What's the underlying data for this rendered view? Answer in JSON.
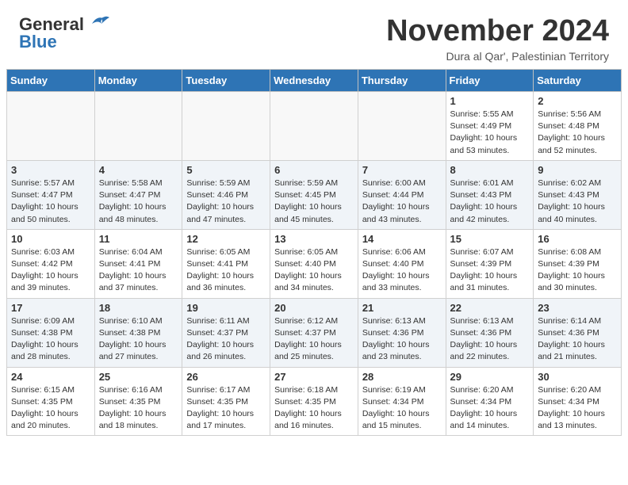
{
  "header": {
    "logo_line1": "General",
    "logo_line2": "Blue",
    "month": "November 2024",
    "location": "Dura al Qar', Palestinian Territory"
  },
  "weekdays": [
    "Sunday",
    "Monday",
    "Tuesday",
    "Wednesday",
    "Thursday",
    "Friday",
    "Saturday"
  ],
  "weeks": [
    [
      {
        "day": "",
        "info": ""
      },
      {
        "day": "",
        "info": ""
      },
      {
        "day": "",
        "info": ""
      },
      {
        "day": "",
        "info": ""
      },
      {
        "day": "",
        "info": ""
      },
      {
        "day": "1",
        "info": "Sunrise: 5:55 AM\nSunset: 4:49 PM\nDaylight: 10 hours and 53 minutes."
      },
      {
        "day": "2",
        "info": "Sunrise: 5:56 AM\nSunset: 4:48 PM\nDaylight: 10 hours and 52 minutes."
      }
    ],
    [
      {
        "day": "3",
        "info": "Sunrise: 5:57 AM\nSunset: 4:47 PM\nDaylight: 10 hours and 50 minutes."
      },
      {
        "day": "4",
        "info": "Sunrise: 5:58 AM\nSunset: 4:47 PM\nDaylight: 10 hours and 48 minutes."
      },
      {
        "day": "5",
        "info": "Sunrise: 5:59 AM\nSunset: 4:46 PM\nDaylight: 10 hours and 47 minutes."
      },
      {
        "day": "6",
        "info": "Sunrise: 5:59 AM\nSunset: 4:45 PM\nDaylight: 10 hours and 45 minutes."
      },
      {
        "day": "7",
        "info": "Sunrise: 6:00 AM\nSunset: 4:44 PM\nDaylight: 10 hours and 43 minutes."
      },
      {
        "day": "8",
        "info": "Sunrise: 6:01 AM\nSunset: 4:43 PM\nDaylight: 10 hours and 42 minutes."
      },
      {
        "day": "9",
        "info": "Sunrise: 6:02 AM\nSunset: 4:43 PM\nDaylight: 10 hours and 40 minutes."
      }
    ],
    [
      {
        "day": "10",
        "info": "Sunrise: 6:03 AM\nSunset: 4:42 PM\nDaylight: 10 hours and 39 minutes."
      },
      {
        "day": "11",
        "info": "Sunrise: 6:04 AM\nSunset: 4:41 PM\nDaylight: 10 hours and 37 minutes."
      },
      {
        "day": "12",
        "info": "Sunrise: 6:05 AM\nSunset: 4:41 PM\nDaylight: 10 hours and 36 minutes."
      },
      {
        "day": "13",
        "info": "Sunrise: 6:05 AM\nSunset: 4:40 PM\nDaylight: 10 hours and 34 minutes."
      },
      {
        "day": "14",
        "info": "Sunrise: 6:06 AM\nSunset: 4:40 PM\nDaylight: 10 hours and 33 minutes."
      },
      {
        "day": "15",
        "info": "Sunrise: 6:07 AM\nSunset: 4:39 PM\nDaylight: 10 hours and 31 minutes."
      },
      {
        "day": "16",
        "info": "Sunrise: 6:08 AM\nSunset: 4:39 PM\nDaylight: 10 hours and 30 minutes."
      }
    ],
    [
      {
        "day": "17",
        "info": "Sunrise: 6:09 AM\nSunset: 4:38 PM\nDaylight: 10 hours and 28 minutes."
      },
      {
        "day": "18",
        "info": "Sunrise: 6:10 AM\nSunset: 4:38 PM\nDaylight: 10 hours and 27 minutes."
      },
      {
        "day": "19",
        "info": "Sunrise: 6:11 AM\nSunset: 4:37 PM\nDaylight: 10 hours and 26 minutes."
      },
      {
        "day": "20",
        "info": "Sunrise: 6:12 AM\nSunset: 4:37 PM\nDaylight: 10 hours and 25 minutes."
      },
      {
        "day": "21",
        "info": "Sunrise: 6:13 AM\nSunset: 4:36 PM\nDaylight: 10 hours and 23 minutes."
      },
      {
        "day": "22",
        "info": "Sunrise: 6:13 AM\nSunset: 4:36 PM\nDaylight: 10 hours and 22 minutes."
      },
      {
        "day": "23",
        "info": "Sunrise: 6:14 AM\nSunset: 4:36 PM\nDaylight: 10 hours and 21 minutes."
      }
    ],
    [
      {
        "day": "24",
        "info": "Sunrise: 6:15 AM\nSunset: 4:35 PM\nDaylight: 10 hours and 20 minutes."
      },
      {
        "day": "25",
        "info": "Sunrise: 6:16 AM\nSunset: 4:35 PM\nDaylight: 10 hours and 18 minutes."
      },
      {
        "day": "26",
        "info": "Sunrise: 6:17 AM\nSunset: 4:35 PM\nDaylight: 10 hours and 17 minutes."
      },
      {
        "day": "27",
        "info": "Sunrise: 6:18 AM\nSunset: 4:35 PM\nDaylight: 10 hours and 16 minutes."
      },
      {
        "day": "28",
        "info": "Sunrise: 6:19 AM\nSunset: 4:34 PM\nDaylight: 10 hours and 15 minutes."
      },
      {
        "day": "29",
        "info": "Sunrise: 6:20 AM\nSunset: 4:34 PM\nDaylight: 10 hours and 14 minutes."
      },
      {
        "day": "30",
        "info": "Sunrise: 6:20 AM\nSunset: 4:34 PM\nDaylight: 10 hours and 13 minutes."
      }
    ]
  ]
}
